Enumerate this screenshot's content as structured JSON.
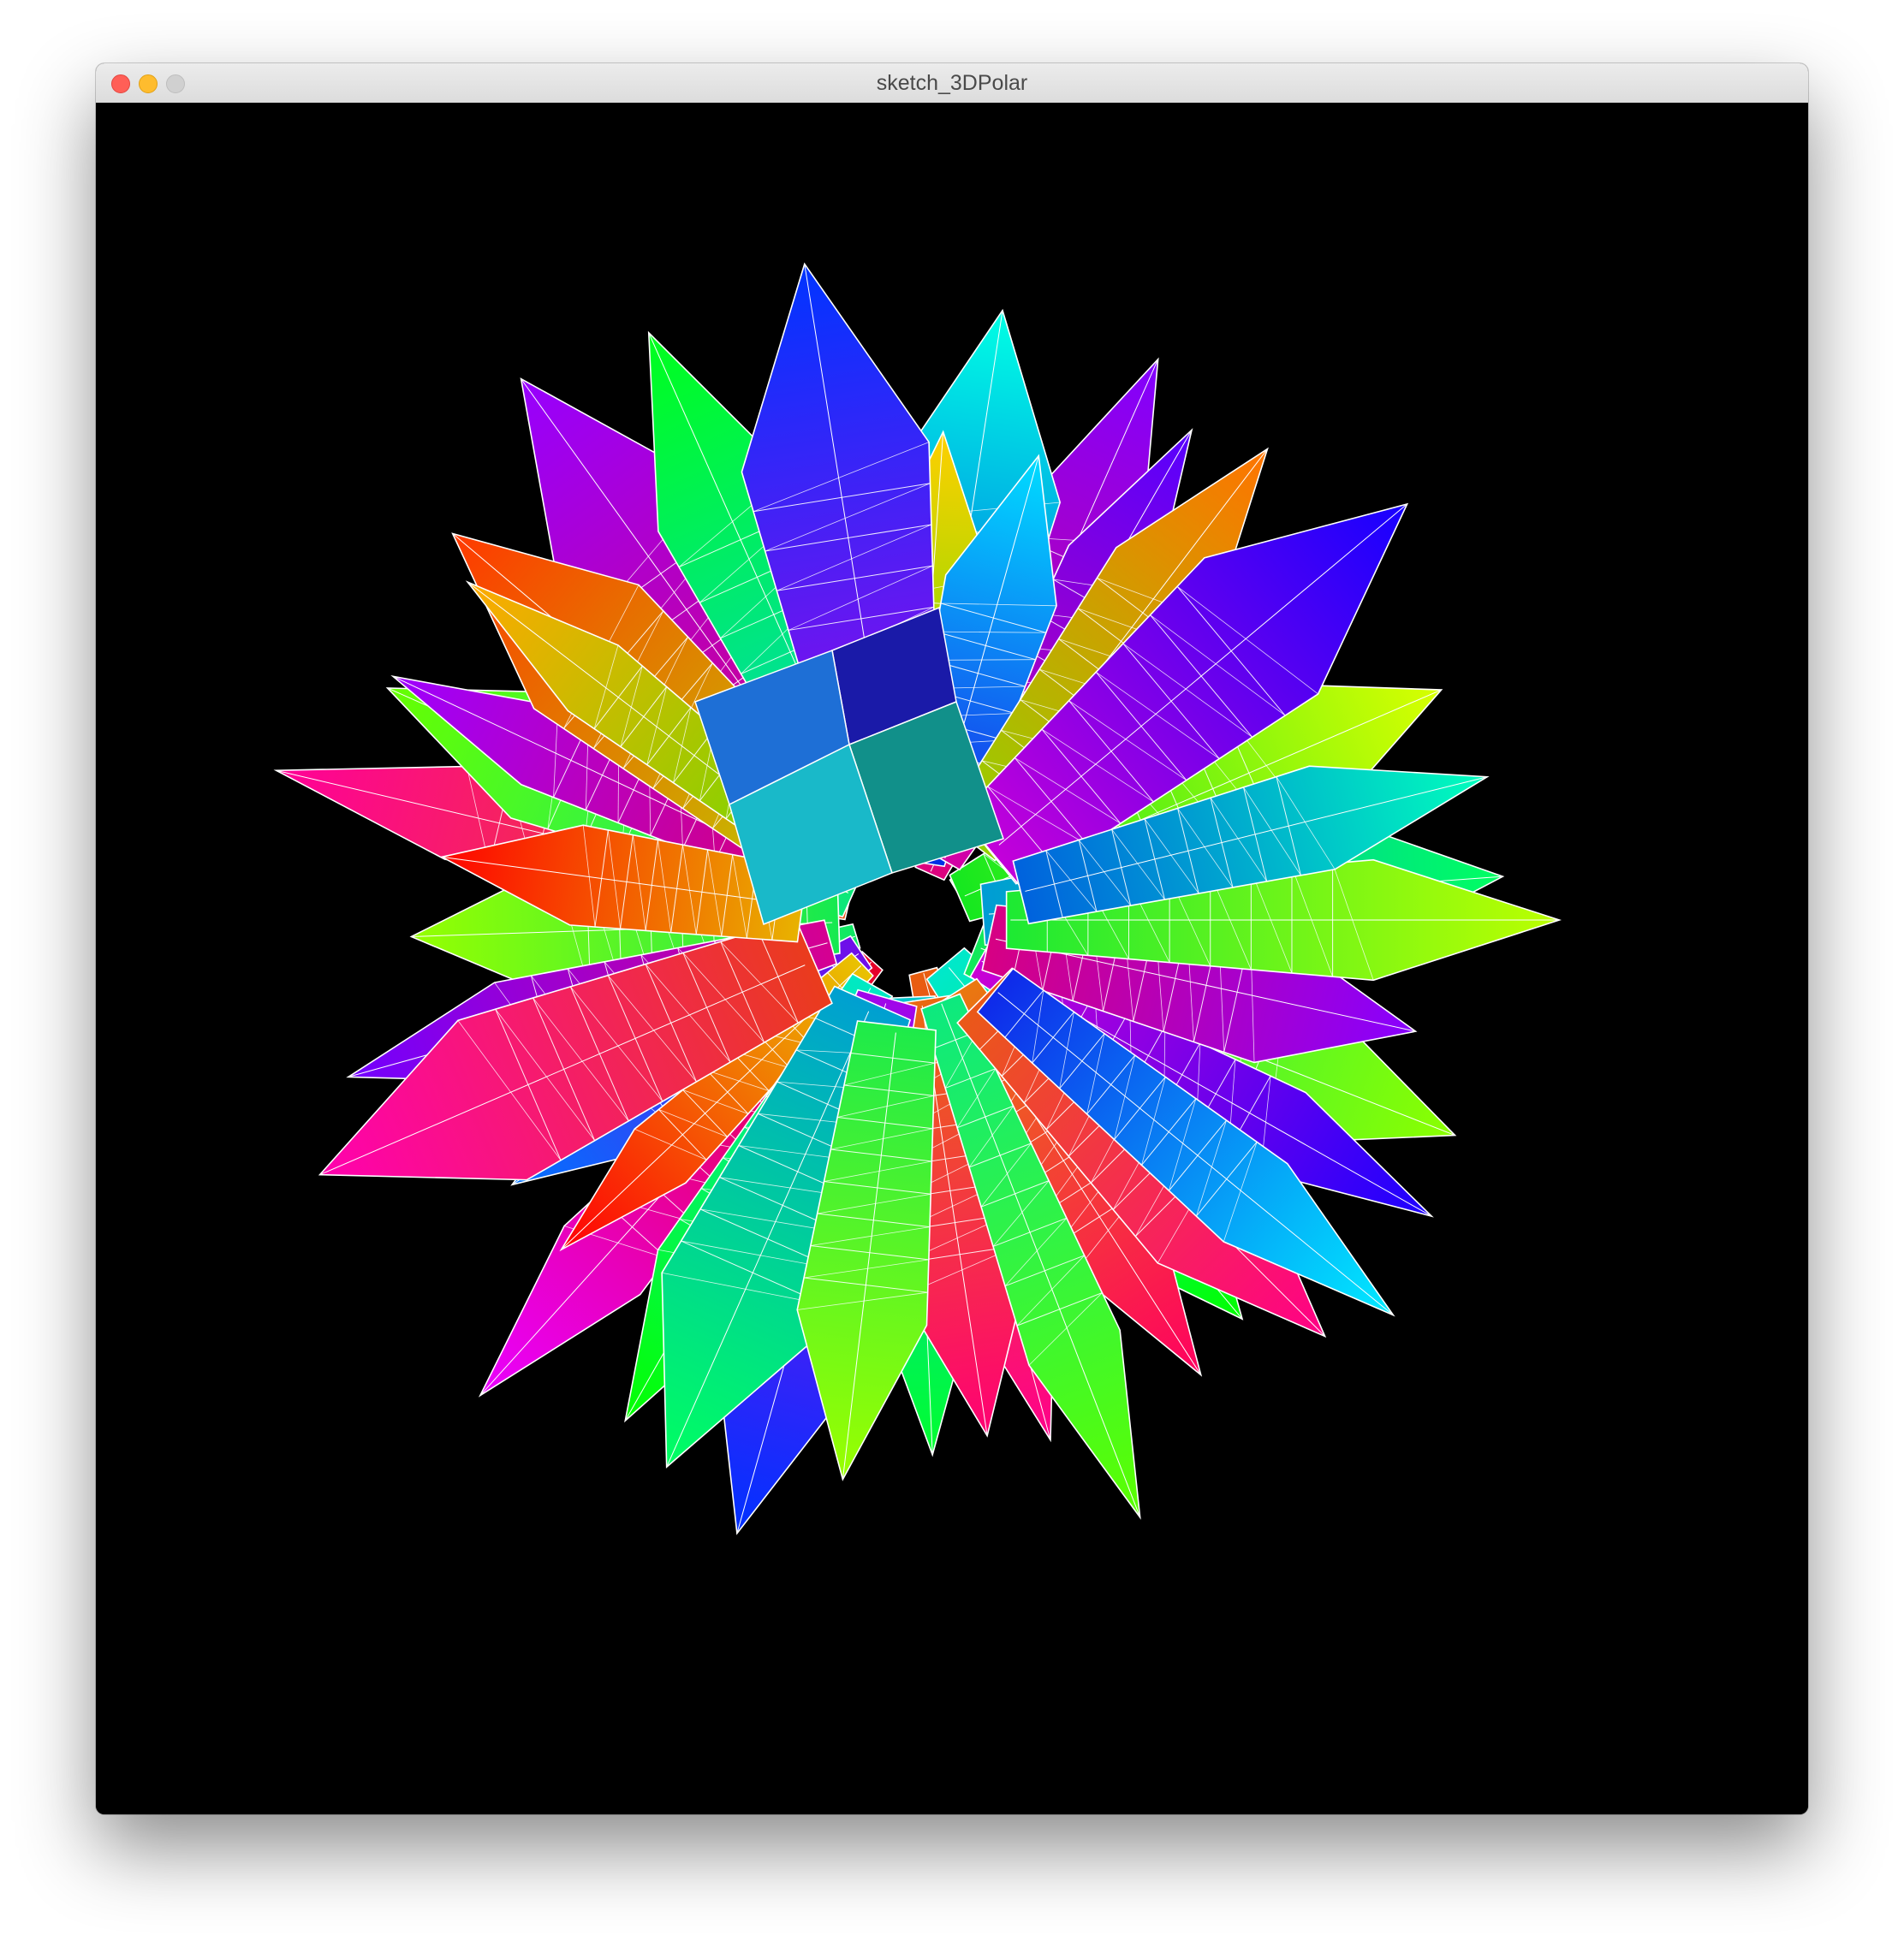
{
  "window": {
    "title": "sketch_3DPolar",
    "controls": {
      "close_color": "#ff5f57",
      "minimize_color": "#febc2e",
      "zoom_color": "#d0d0d0"
    }
  },
  "canvas": {
    "background": "#000000",
    "content": "3d-polar-wireframe-starburst",
    "mesh_color": "#ffffff"
  }
}
